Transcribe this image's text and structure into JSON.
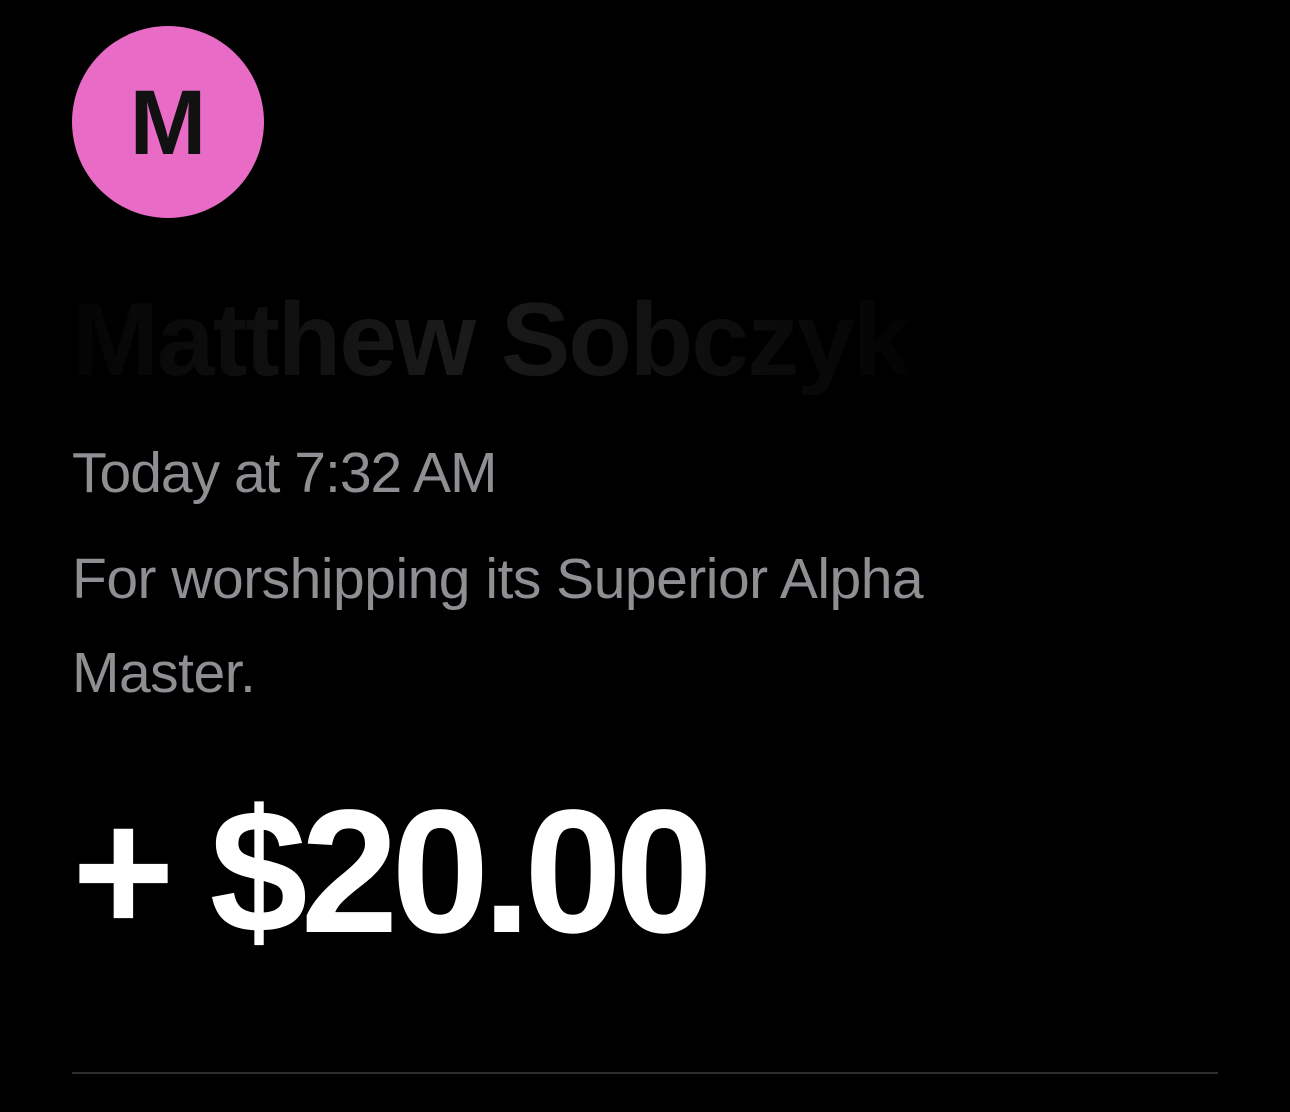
{
  "transaction": {
    "avatar": {
      "initial": "M",
      "color": "#e86bc6"
    },
    "sender_name": "Matthew Sobczyk",
    "timestamp": "Today at 7:32 AM",
    "note": "For worshipping its Superior Alpha Master.",
    "amount": "+ $20.00"
  },
  "colors": {
    "background": "#000000",
    "secondary_text": "#8e8e93",
    "amount_text": "#ffffff",
    "divider": "#2c2c2e"
  }
}
